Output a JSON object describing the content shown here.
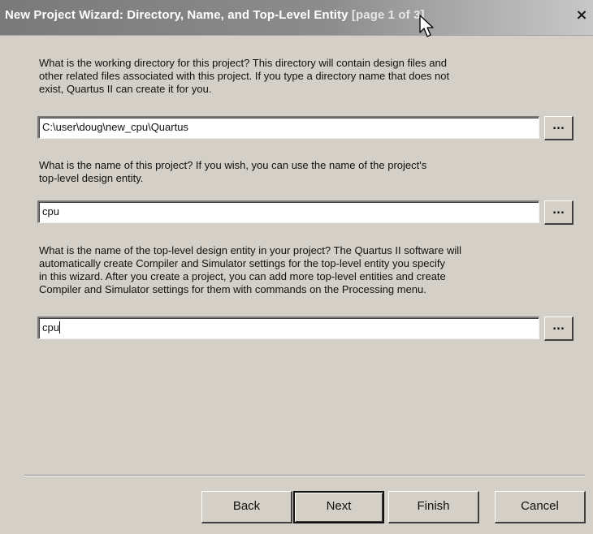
{
  "dialog": {
    "title": "New Project Wizard: Directory, Name, and Top-Level Entity",
    "page_indicator": "[page 1 of 3]",
    "close_label": "×"
  },
  "directory": {
    "prompt_lines": [
      "What is the working directory for this project?  This directory will contain design files and",
      "other related files associated with this project.  If you type a directory name that does not",
      "exist, Quartus II can create it for you."
    ],
    "value": "C:\\user\\doug\\new_cpu\\Quartus",
    "browse_label": "..."
  },
  "project_name": {
    "prompt_lines": [
      "What is the name of this project?  If you wish, you can use the name of the project's",
      "top-level design entity."
    ],
    "value": "cpu",
    "browse_label": "..."
  },
  "top_level_entity": {
    "prompt_lines": [
      "What is the name of the top-level design entity in your project?  The Quartus II software will",
      "automatically create Compiler and Simulator settings for the top-level entity you specify",
      "in this wizard.  After you create a project, you can add more top-level entities and create",
      "Compiler and Simulator settings for them with commands on the Processing menu."
    ],
    "value": "cpu",
    "browse_label": "..."
  },
  "footer": {
    "back_label": "Back",
    "next_label": "Next",
    "finish_label": "Finish",
    "cancel_label": "Cancel"
  },
  "icons": {
    "cursor": "mouse-pointer-icon"
  }
}
